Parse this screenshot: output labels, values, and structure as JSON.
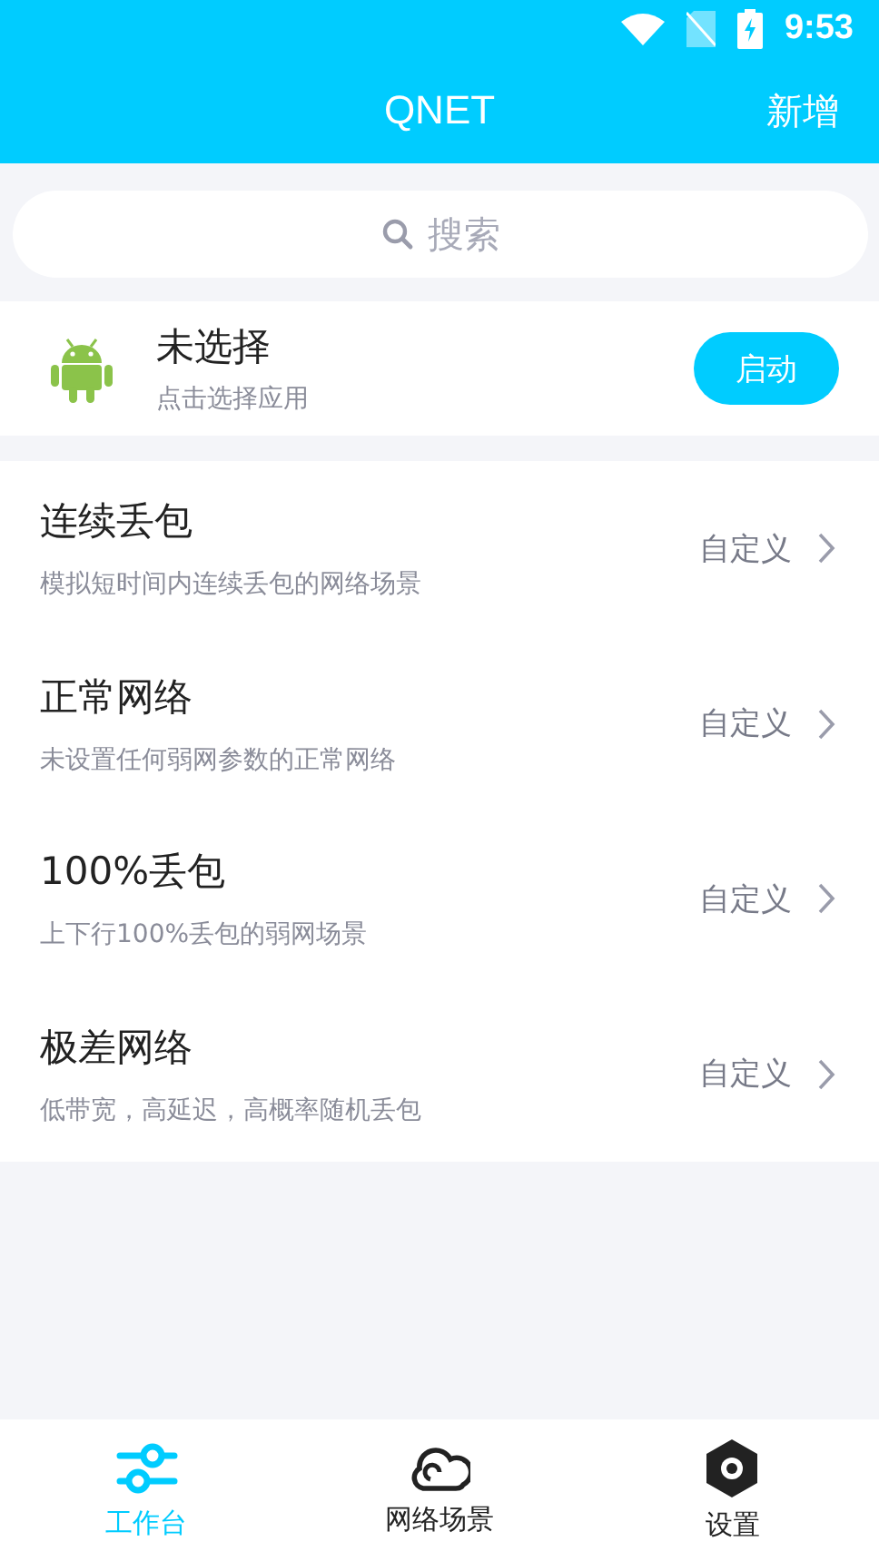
{
  "status_bar": {
    "time": "9:53"
  },
  "header": {
    "title": "QNET",
    "action": "新增"
  },
  "search": {
    "placeholder": "搜索"
  },
  "app": {
    "name": "未选择",
    "hint": "点击选择应用",
    "button": "启动"
  },
  "scenes": [
    {
      "title": "连续丢包",
      "description": "模拟短时间内连续丢包的网络场景",
      "action": "自定义"
    },
    {
      "title": "正常网络",
      "description": "未设置任何弱网参数的正常网络",
      "action": "自定义"
    },
    {
      "title": "100%丢包",
      "description": "上下行100%丢包的弱网场景",
      "action": "自定义"
    },
    {
      "title": "极差网络",
      "description": "低带宽，高延迟，高概率随机丢包",
      "action": "自定义"
    }
  ],
  "tabs": [
    {
      "kind": "sliders",
      "label": "工作台",
      "selected": true
    },
    {
      "kind": "cloud",
      "label": "网络场景",
      "selected": false
    },
    {
      "kind": "settings",
      "label": "设置",
      "selected": false
    }
  ]
}
